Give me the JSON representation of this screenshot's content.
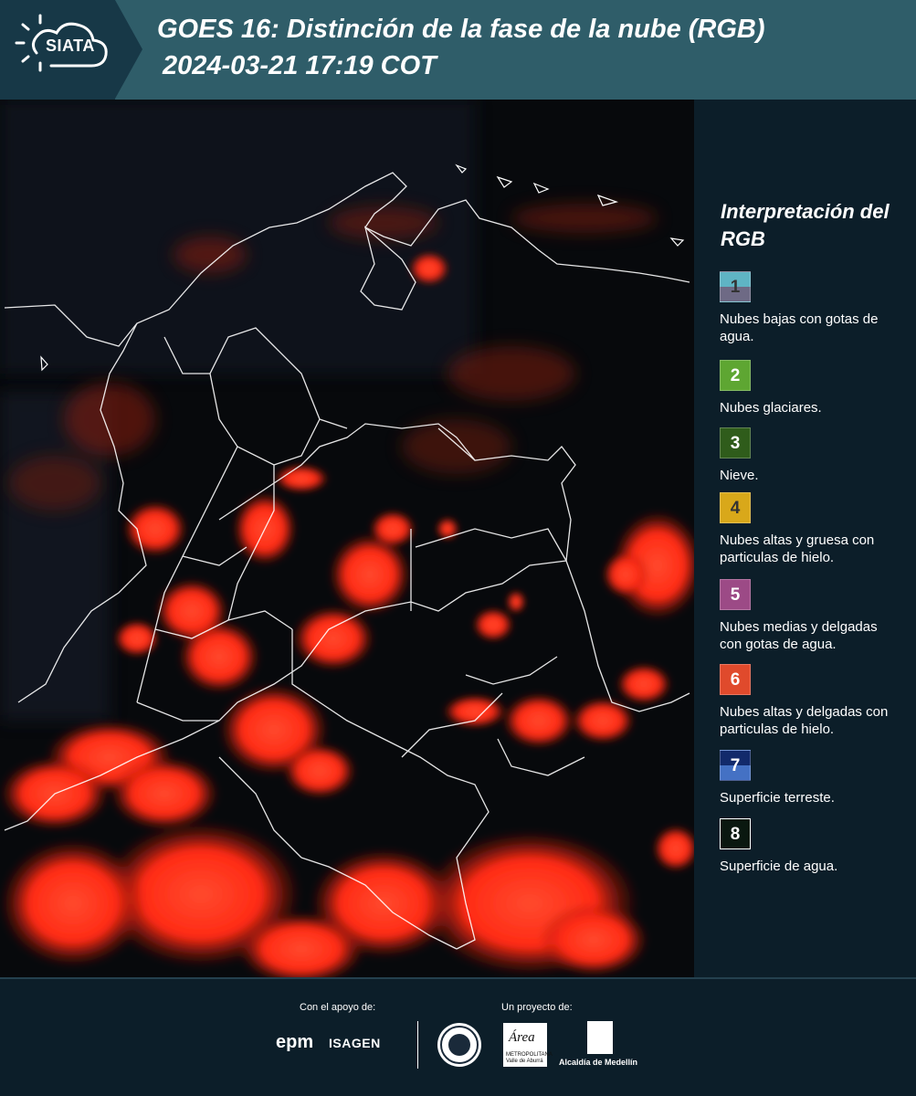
{
  "header": {
    "logo_text": "SIATA",
    "title": "GOES 16: Distinción de la fase de la nube (RGB)",
    "datetime": "2024-03-21 17:19 COT"
  },
  "legend": {
    "title": "Interpretación del RGB",
    "items": [
      {
        "number": "1",
        "text": "Nubes bajas con gotas de agua.",
        "color_top": "#5fb4c4",
        "color_bottom": "#6e6a85",
        "number_color": "#333333"
      },
      {
        "number": "2",
        "text": "Nubes glaciares.",
        "color_top": "#5ea632",
        "color_bottom": "#5ea632",
        "number_color": "#ffffff"
      },
      {
        "number": "3",
        "text": "Nieve.",
        "color_top": "#2f5c1b",
        "color_bottom": "#2f5c1b",
        "number_color": "#ffffff"
      },
      {
        "number": "4",
        "text": "Nubes altas y gruesa con particulas de hielo.",
        "color_top": "#d9a81a",
        "color_bottom": "#d9a81a",
        "number_color": "#333333"
      },
      {
        "number": "5",
        "text": "Nubes medias y delgadas con gotas de agua.",
        "color_top": "#9c4a86",
        "color_bottom": "#9c4a86",
        "number_color": "#ffffff"
      },
      {
        "number": "6",
        "text": "Nubes altas y delgadas con particulas de hielo.",
        "color_top": "#e04a2c",
        "color_bottom": "#e04a2c",
        "number_color": "#ffffff"
      },
      {
        "number": "7",
        "text": "Superficie terreste.",
        "color_top": "#122a6b",
        "color_bottom": "#4471c4",
        "number_color": "#ffffff"
      },
      {
        "number": "8",
        "text": "Superficie de agua.",
        "color_top": "#0a1810",
        "color_bottom": "#0a1810",
        "number_color": "#ffffff"
      }
    ]
  },
  "footer": {
    "support_label": "Con el apoyo de:",
    "project_label": "Un proyecto de:",
    "epm": "epm",
    "isagen": "ISAGEN",
    "area_word": "Área",
    "area_sub": "METROPOLITANA Valle de Aburrá",
    "alcaldia": "Alcaldía de Medellín"
  },
  "colors": {
    "header_bg": "#2f5d69",
    "logo_bg": "#173847",
    "panel_bg": "#0c1e29",
    "cloud_red": "#ff2a14"
  }
}
